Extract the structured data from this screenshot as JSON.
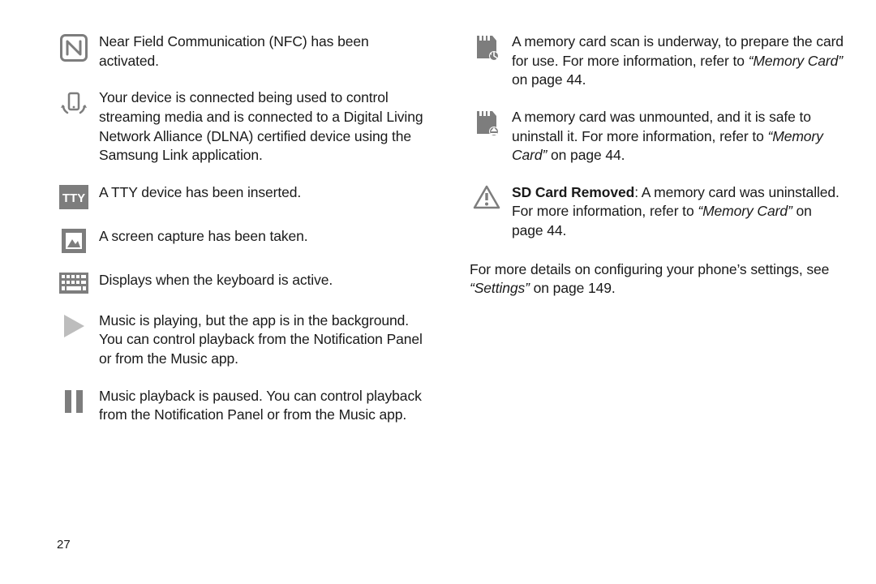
{
  "left": [
    {
      "icon": "nfc",
      "text": "Near Field Communication (NFC) has been activated."
    },
    {
      "icon": "dlna",
      "text": "Your device is connected being used to control streaming media and is connected to a Digital Living Network Alliance (DLNA) certified device using the Samsung Link application."
    },
    {
      "icon": "tty",
      "text": "A TTY device has been inserted."
    },
    {
      "icon": "screenshot",
      "text": "A screen capture has been taken."
    },
    {
      "icon": "keyboard",
      "text": "Displays when the keyboard is active."
    },
    {
      "icon": "play",
      "text": "Music is playing, but the app is in the background. You can control playback from the Notification Panel or from the Music app."
    },
    {
      "icon": "pause",
      "text": "Music playback is paused. You can control playback from the Notification Panel or from the Music app."
    }
  ],
  "right": [
    {
      "icon": "sd-scan",
      "text": "A memory card scan is underway, to prepare the card for use. For more information, refer to ",
      "ref_title": "“Memory Card”",
      "ref_tail": " on page 44."
    },
    {
      "icon": "sd-unmount",
      "text": "A memory card was unmounted, and it is safe to uninstall it. For more information, refer to ",
      "ref_title": "“Memory Card”",
      "ref_tail": " on page 44."
    },
    {
      "icon": "alert",
      "boldhead": "SD Card Removed",
      "text": ": A memory card was uninstalled. For more information, refer to ",
      "ref_title": "“Memory Card”",
      "ref_tail": " on page 44."
    }
  ],
  "footer": {
    "text": "For more details on configuring your phone’s settings, see ",
    "ref_title": "“Settings”",
    "ref_tail": " on page 149."
  },
  "page_number": "27"
}
